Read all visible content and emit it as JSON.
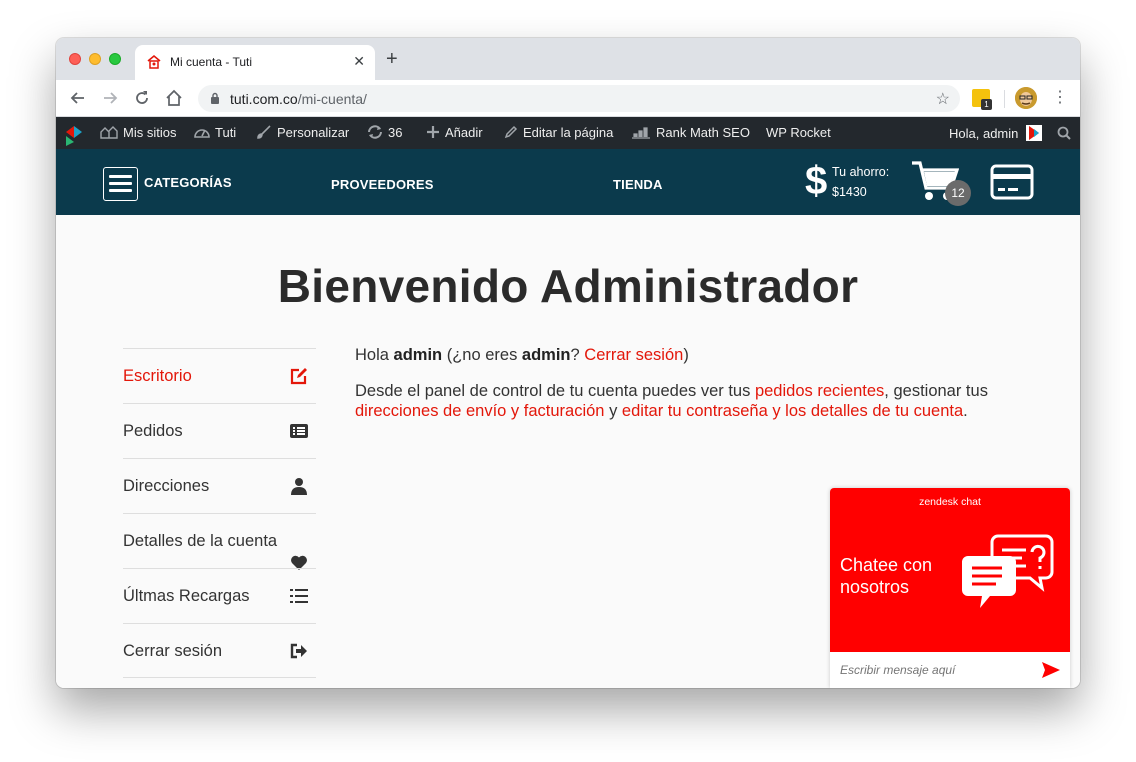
{
  "browser": {
    "tab_title": "Mi cuenta - Tuti",
    "new_tab_label": "+",
    "tab_close": "✕",
    "url_host": "tuti.com.co",
    "url_path": "/mi-cuenta/",
    "extension_badge": "1"
  },
  "adminbar": {
    "items": [
      {
        "label": "Mis sitios",
        "icon": "sites-icon"
      },
      {
        "label": "Tuti",
        "icon": "dashboard-icon"
      },
      {
        "label": "Personalizar",
        "icon": "brush-icon"
      },
      {
        "label": "36",
        "icon": "updates-icon"
      },
      {
        "label": "Añadir",
        "icon": "plus-icon"
      },
      {
        "label": "Editar la página",
        "icon": "pencil-icon"
      },
      {
        "label": "Rank Math SEO",
        "icon": "rankmath-icon"
      },
      {
        "label": "WP Rocket",
        "icon": ""
      }
    ],
    "greeting": "Hola, admin"
  },
  "header": {
    "categories": "CATEGORÍAS",
    "providers": "PROVEEDORES",
    "store": "TIENDA",
    "dollar": "$",
    "saving_label": "Tu ahorro:",
    "saving_value": "$1430",
    "cart_count": "12"
  },
  "page": {
    "title": "Bienvenido Administrador"
  },
  "account_menu": [
    {
      "label": "Escritorio",
      "icon": "edit-icon",
      "active": true
    },
    {
      "label": "Pedidos",
      "icon": "list-icon",
      "active": false
    },
    {
      "label": "Direcciones",
      "icon": "user-icon",
      "active": false
    },
    {
      "label": "Detalles de la cuenta",
      "icon": "heart-icon",
      "active": false
    },
    {
      "label": "Últmas Recargas",
      "icon": "list-ol-icon",
      "active": false
    },
    {
      "label": "Cerrar sesión",
      "icon": "sign-out-icon",
      "active": false
    }
  ],
  "welcome": {
    "hola": "Hola",
    "user": "admin",
    "not_you_prefix": "(¿no eres",
    "user2": "admin",
    "q": "?",
    "logout_link": "Cerrar sesión",
    "close_paren": ")",
    "p1": "Desde el panel de control de tu cuenta puedes ver tus",
    "link_orders": "pedidos recientes",
    "p2": ", gestionar tus",
    "link_addresses": "direcciones de envío y facturación",
    "p3": "y",
    "link_account": "editar tu contraseña y los detalles de tu cuenta",
    "p4": "."
  },
  "chat": {
    "brand": "zendesk chat",
    "cta": "Chatee con nosotros",
    "placeholder": "Escribir mensaje aquí"
  },
  "colors": {
    "accent": "#e3170a",
    "header_bg": "#0b3a4c",
    "adminbar_bg": "#23282d",
    "chat_red": "#ff0000"
  }
}
